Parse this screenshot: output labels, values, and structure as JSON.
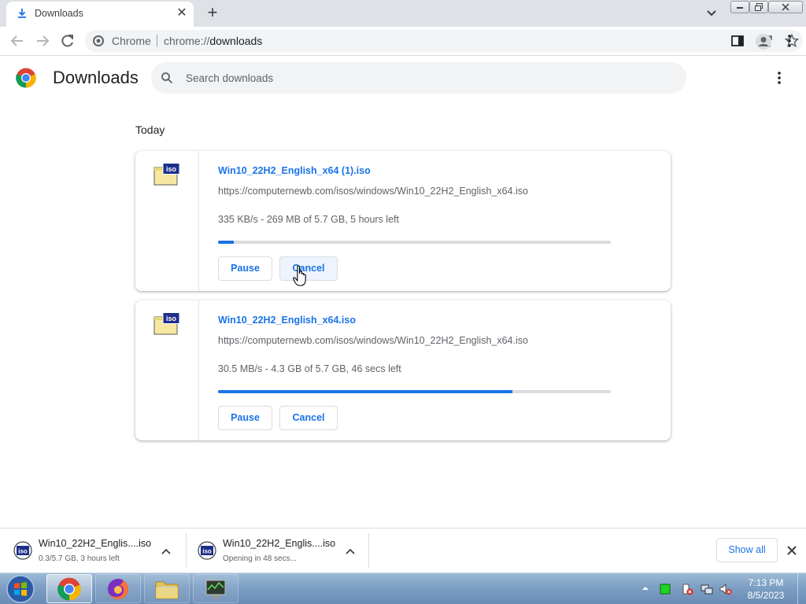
{
  "browser": {
    "tab": {
      "title": "Downloads",
      "close": "✕"
    },
    "new_tab": "+",
    "omnibox": {
      "chip": "Chrome",
      "scheme": "chrome://",
      "host": "downloads"
    }
  },
  "page": {
    "title": "Downloads",
    "search": {
      "placeholder": "Search downloads",
      "value": ""
    }
  },
  "downloads": {
    "date_header": "Today",
    "items": [
      {
        "file_name": "Win10_22H2_English_x64 (1).iso",
        "url": "https://computernewb.com/isos/windows/Win10_22H2_English_x64.iso",
        "status": "335 KB/s - 269 MB of 5.7 GB, 5 hours left",
        "progress": 0.04,
        "pause_label": "Pause",
        "cancel_label": "Cancel"
      },
      {
        "file_name": "Win10_22H2_English_x64.iso",
        "url": "https://computernewb.com/isos/windows/Win10_22H2_English_x64.iso",
        "status": "30.5 MB/s - 4.3 GB of 5.7 GB, 46 secs left",
        "progress": 0.75,
        "pause_label": "Pause",
        "cancel_label": "Cancel"
      }
    ]
  },
  "shelf": {
    "items": [
      {
        "name": "Win10_22H2_Englis....iso",
        "sub": "0.3/5.7 GB, 3 hours left"
      },
      {
        "name": "Win10_22H2_Englis....iso",
        "sub": "Opening in 48 secs..."
      }
    ],
    "show_all": "Show all"
  },
  "taskbar": {
    "apps": [
      "chrome",
      "firefox",
      "explorer",
      "network-app"
    ],
    "clock": {
      "time": "7:13 PM",
      "date": "8/5/2023"
    }
  },
  "colors": {
    "accent": "#1a73e8",
    "progress_track": "#dadce0",
    "tabstrip": "#dee1e6"
  }
}
